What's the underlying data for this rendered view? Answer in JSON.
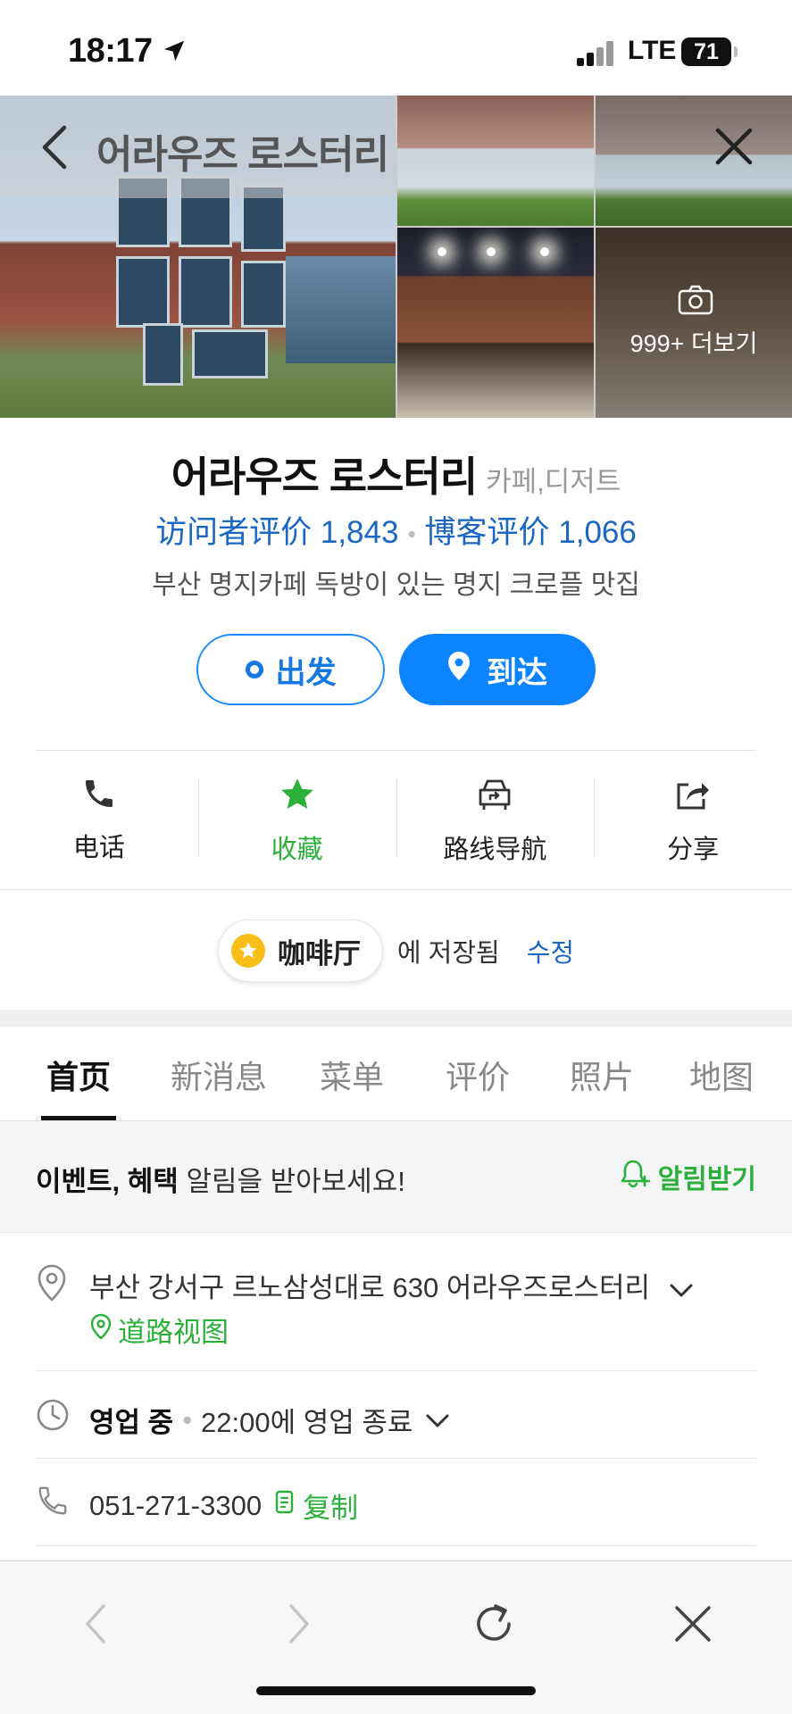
{
  "status_bar": {
    "time": "18:17",
    "network": "LTE",
    "battery": "71"
  },
  "header": {
    "title": "어라우즈 로스터리"
  },
  "gallery": {
    "more_label": "999+ 더보기"
  },
  "place": {
    "name": "어라우즈 로스터리",
    "category": "카페,디저트",
    "visitor_reviews": "访问者评价 1,843",
    "blog_reviews": "博客评价 1,066",
    "description": "부산 명지카페 독방이 있는 명지 크로플 맛집"
  },
  "route_buttons": {
    "depart": "出发",
    "arrive": "到达"
  },
  "actions": [
    {
      "label": "电话",
      "icon": "phone-icon"
    },
    {
      "label": "收藏",
      "icon": "star-icon"
    },
    {
      "label": "路线导航",
      "icon": "navigation-icon"
    },
    {
      "label": "分享",
      "icon": "share-icon"
    }
  ],
  "saved": {
    "list_name": "咖啡厅",
    "saved_text": "에 저장됨",
    "edit_label": "수정"
  },
  "tabs": [
    "首页",
    "新消息",
    "菜单",
    "评价",
    "照片",
    "地图"
  ],
  "notice": {
    "bold": "이벤트, 혜택",
    "rest": " 알림을 받아보세요!",
    "button": "알림받기"
  },
  "info": {
    "address": "부산 강서구 르노삼성대로 630 어라우즈로스터리",
    "street_view": "道路视图",
    "status": "영업 중",
    "closing": "22:00에 영업 종료",
    "phone": "051-271-3300",
    "copy": "复制"
  },
  "colors": {
    "accent_blue": "#0d84ff",
    "link_blue": "#1a67c4",
    "accent_green": "#2bb03a",
    "star_yellow": "#f8bd16"
  }
}
